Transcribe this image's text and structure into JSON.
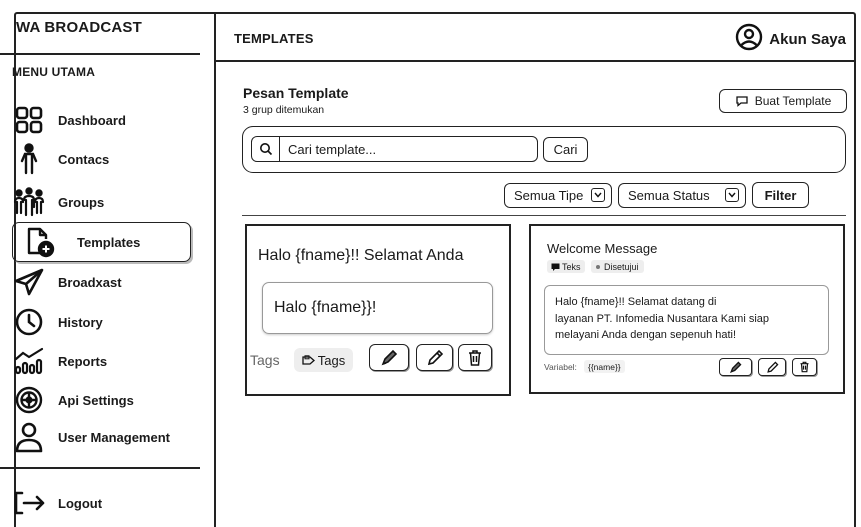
{
  "app": {
    "brand": "WA BROADCAST"
  },
  "sidebar": {
    "menu_heading": "MENU UTAMA",
    "items": [
      {
        "label": "Dashboard",
        "icon": "dashboard-grid-icon"
      },
      {
        "label": "Contacs",
        "icon": "person-icon"
      },
      {
        "label": "Groups",
        "icon": "group-icon"
      },
      {
        "label": "Templates",
        "icon": "document-add-icon",
        "active": true
      },
      {
        "label": "Broadxast",
        "icon": "send-icon"
      },
      {
        "label": "History",
        "icon": "clock-icon"
      },
      {
        "label": "Reports",
        "icon": "chart-icon"
      },
      {
        "label": "Api Settings",
        "icon": "gear-icon"
      },
      {
        "label": "User Management",
        "icon": "user-icon"
      }
    ],
    "logout_label": "Logout"
  },
  "header": {
    "title": "TEMPLATES",
    "account_label": "Akun Saya"
  },
  "main": {
    "section_title": "Pesan Template",
    "section_subtitle": "3 grup ditemukan",
    "create_button": "Buat Template",
    "search_placeholder": "Cari template...",
    "search_button": "Cari",
    "type_filter": "Semua Tipe",
    "status_filter": "Semua Status",
    "filter_button": "Filter"
  },
  "cards": [
    {
      "title": "Halo {fname}!! Selamat Anda",
      "preview": "Halo {fname}}!",
      "tags_label": "Tags",
      "tag": "Tags"
    },
    {
      "title": "Welcome Message",
      "type_badge": "Teks",
      "status_badge": "Disetujui",
      "body_lines": [
        "Halo {fname}!! Selamat datang di",
        "layanan PT. Infomedia Nusantara Kami siap",
        "melayani Anda dengan sepenuh hati!"
      ],
      "variable_label": "Variabel:",
      "variable": "{{name}}"
    }
  ]
}
